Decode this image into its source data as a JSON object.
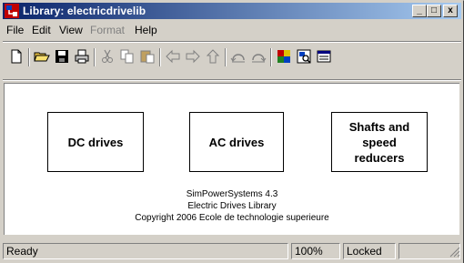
{
  "window": {
    "title": "Library: electricdrivelib"
  },
  "title_buttons": {
    "minimize": "_",
    "maximize": "□",
    "close": "x"
  },
  "menu": {
    "file": "File",
    "edit": "Edit",
    "view": "View",
    "format": "Format",
    "help": "Help"
  },
  "toolbar": {
    "icons": [
      "new-file-icon",
      "open-folder-icon",
      "save-icon",
      "print-icon",
      "cut-icon",
      "copy-icon",
      "paste-icon",
      "back-icon",
      "forward-icon",
      "up-icon",
      "undo-icon",
      "redo-icon",
      "library-browser-icon",
      "model-explorer-icon",
      "debugger-icon"
    ]
  },
  "blocks": {
    "dc": "DC drives",
    "ac": "AC drives",
    "shafts": [
      "Shafts and",
      "speed",
      "reducers"
    ]
  },
  "info": {
    "line1": "SimPowerSystems 4.3",
    "line2": "Electric Drives Library",
    "line3": "Copyright  2006 Ecole de technologie superieure"
  },
  "status": {
    "state": "Ready",
    "zoom": "100%",
    "lock": "Locked"
  },
  "colors": {
    "titlebar_start": "#0a246a",
    "titlebar_end": "#a6caf0",
    "chrome": "#d4d0c8"
  }
}
